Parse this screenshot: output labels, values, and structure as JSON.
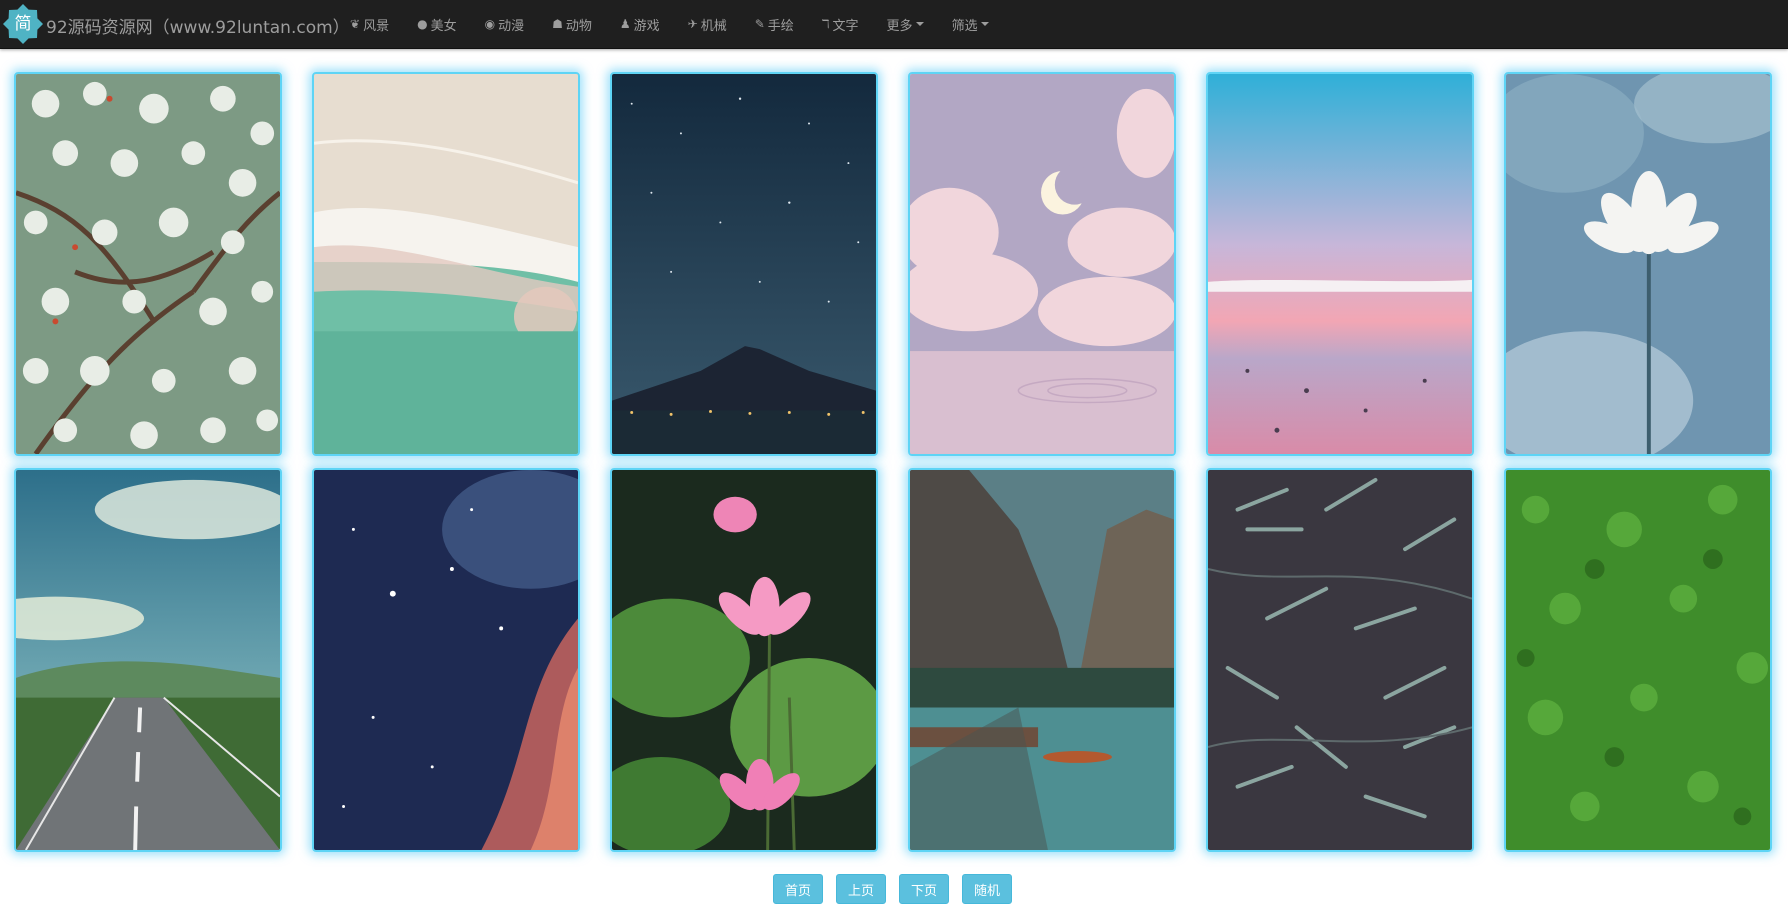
{
  "brand": {
    "logo_char": "简",
    "title": "92源码资源网（www.92luntan.com）"
  },
  "nav": {
    "items": [
      {
        "label": "风景",
        "icon": "leaf-icon",
        "glyph": "❦"
      },
      {
        "label": "美女",
        "icon": "apple-icon",
        "glyph": "●"
      },
      {
        "label": "动漫",
        "icon": "eye-icon",
        "glyph": "◉"
      },
      {
        "label": "动物",
        "icon": "paw-icon",
        "glyph": "☗"
      },
      {
        "label": "游戏",
        "icon": "pawn-icon",
        "glyph": "♟"
      },
      {
        "label": "机械",
        "icon": "plane-icon",
        "glyph": "✈"
      },
      {
        "label": "手绘",
        "icon": "brush-icon",
        "glyph": "✎"
      },
      {
        "label": "文字",
        "icon": "text-size-icon",
        "glyph": "ℸ"
      }
    ],
    "more": {
      "label": "更多"
    },
    "filter": {
      "label": "筛选"
    }
  },
  "gallery": {
    "images": [
      {
        "subject": "cherry-blossom"
      },
      {
        "subject": "beach-shore"
      },
      {
        "subject": "mount-fuji-night"
      },
      {
        "subject": "pink-clouds-moon"
      },
      {
        "subject": "pink-sunset-sea"
      },
      {
        "subject": "white-lotus"
      },
      {
        "subject": "country-road"
      },
      {
        "subject": "nebula-space"
      },
      {
        "subject": "pink-lotus"
      },
      {
        "subject": "mountain-lake"
      },
      {
        "subject": "bamboo-leaves"
      },
      {
        "subject": "green-grass"
      }
    ]
  },
  "pager": {
    "first": "首页",
    "prev": "上页",
    "next": "下页",
    "random": "随机"
  },
  "colors": {
    "navbar": "#1f1f1f",
    "nav_text": "#9d9d9d",
    "logo": "#4fb3c4",
    "card_glow": "#5ed4f5",
    "button": "#5bc0de"
  }
}
